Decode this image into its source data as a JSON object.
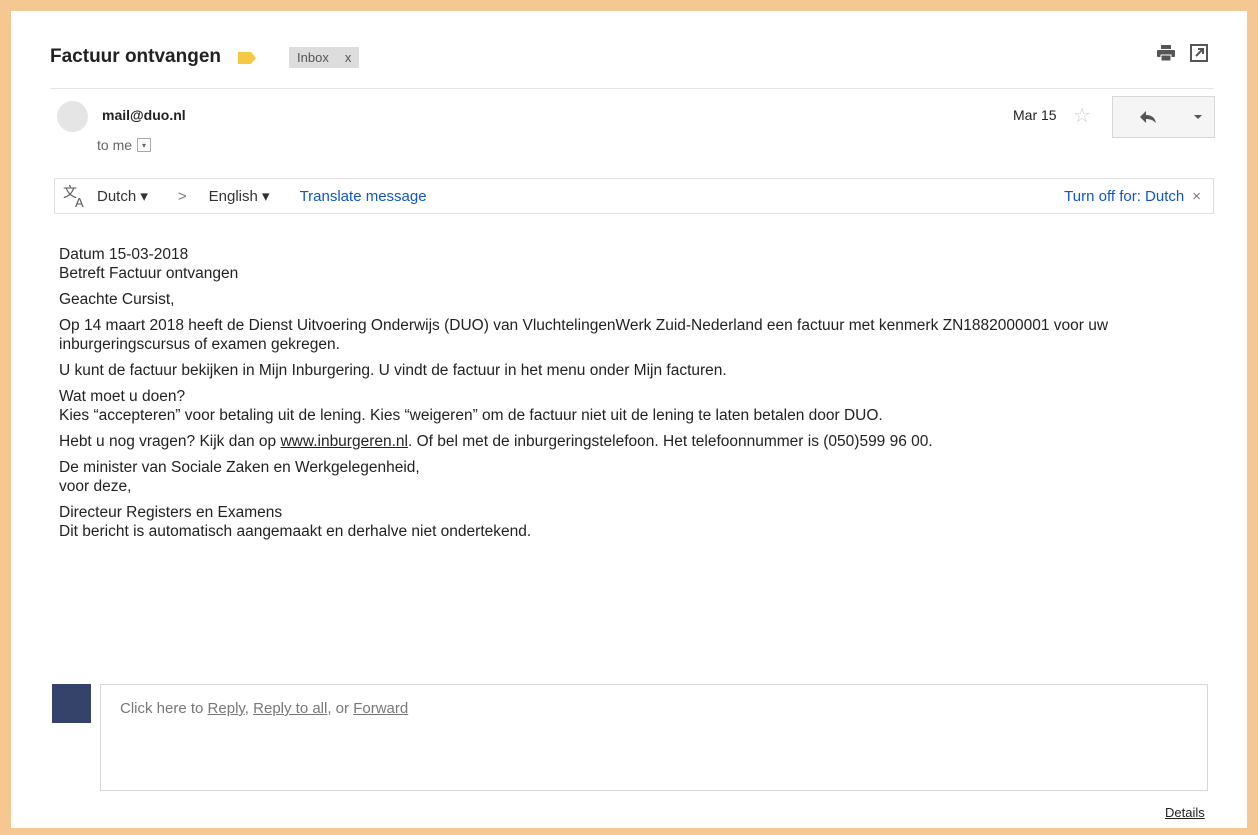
{
  "subject": "Factuur ontvangen",
  "label_color": "#f6c945",
  "inbox_chip": {
    "label": "Inbox",
    "close": "x"
  },
  "top_icons": [
    "print-icon",
    "new-window-icon"
  ],
  "sender": {
    "email": "mail@duo.nl",
    "to": "to me",
    "date": "Mar 15"
  },
  "translate": {
    "from": "Dutch",
    "arrow": ">",
    "to": "English",
    "action": "Translate message",
    "turn_off": "Turn off for: Dutch",
    "close": "×"
  },
  "body": {
    "date_line": "Datum 15-03-2018",
    "subject_line": "Betreft Factuur ontvangen",
    "greeting": "Geachte Cursist,",
    "para1": "Op 14 maart 2018 heeft de Dienst Uitvoering Onderwijs (DUO) van VluchtelingenWerk Zuid-Nederland een factuur met kenmerk ZN1882000001 voor uw inburgeringscursus of examen gekregen.",
    "para2": "U kunt de factuur bekijken in Mijn Inburgering. U vindt de factuur in het menu onder Mijn facturen.",
    "q_heading": "Wat moet u doen?",
    "q_text": "Kies “accepteren” voor betaling uit de lening. Kies “weigeren” om de factuur niet uit de lening te laten betalen door DUO.",
    "contact_pre": "Hebt u nog vragen? Kijk dan op ",
    "contact_link": "www.inburgeren.nl",
    "contact_post": ". Of bel met de inburgeringstelefoon. Het telefoonnummer is (050)599 96 00.",
    "minister": "De minister van Sociale Zaken en Werkgelegenheid,",
    "voor_deze": "voor deze,",
    "director": "Directeur Registers en Examens",
    "auto_note": "Dit bericht is automatisch aangemaakt en derhalve niet ondertekend."
  },
  "reply": {
    "prefix": "Click here to ",
    "reply": "Reply",
    "sep1": ", ",
    "reply_all": "Reply to all",
    "sep2": ", or ",
    "forward": "Forward"
  },
  "details": "Details"
}
